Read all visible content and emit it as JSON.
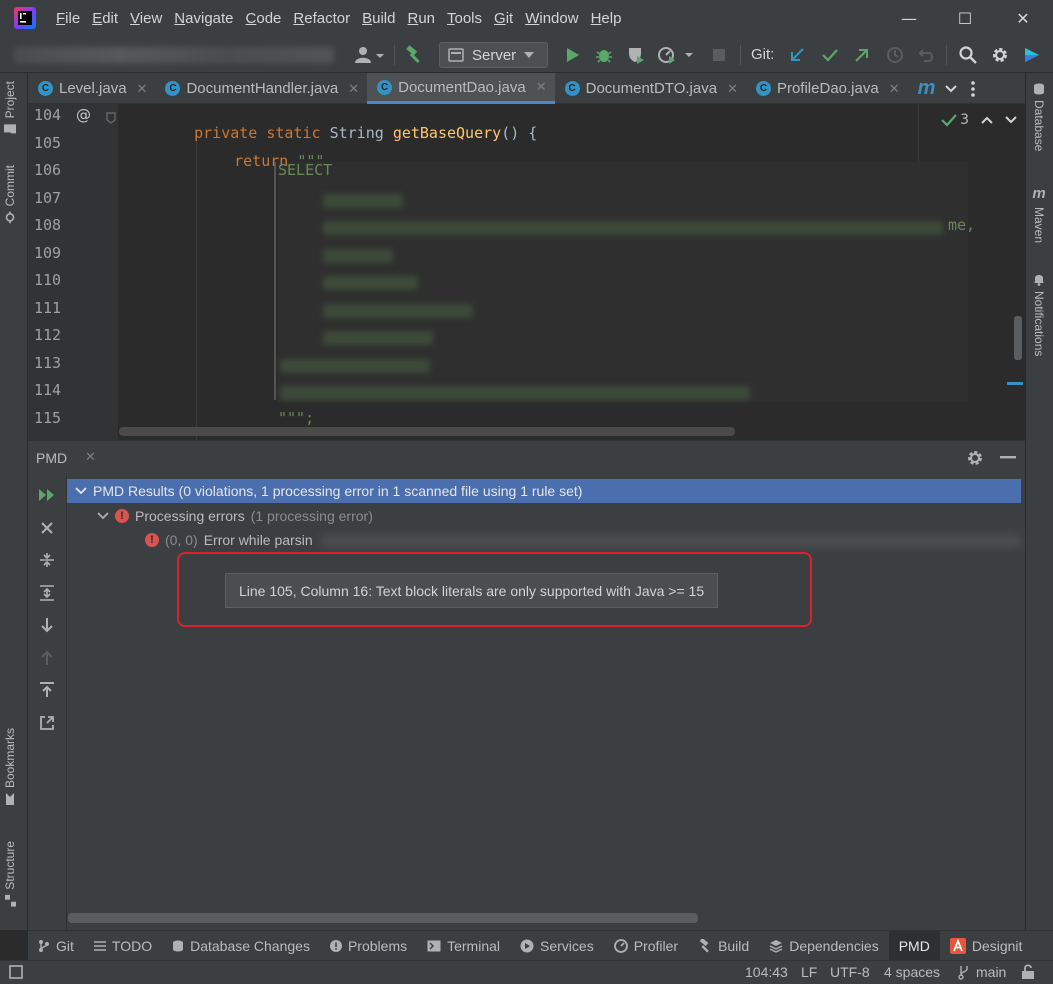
{
  "menu": [
    "File",
    "Edit",
    "View",
    "Navigate",
    "Code",
    "Refactor",
    "Build",
    "Run",
    "Tools",
    "Git",
    "Window",
    "Help"
  ],
  "window_controls": {
    "minimize": "—",
    "maximize": "☐",
    "close": "✕"
  },
  "toolbar": {
    "run_config": "Server",
    "git_label": "Git:"
  },
  "left_strip": {
    "project": "Project",
    "commit": "Commit",
    "bookmarks": "Bookmarks",
    "structure": "Structure"
  },
  "right_strip": {
    "database": "Database",
    "maven": "Maven",
    "notifications": "Notifications"
  },
  "tabs": [
    {
      "label": "Level.java",
      "active": false,
      "icon": "generic-file-icon"
    },
    {
      "label": "DocumentHandler.java",
      "active": false,
      "icon": "class-icon"
    },
    {
      "label": "DocumentDao.java",
      "active": true,
      "icon": "class-icon"
    },
    {
      "label": "DocumentDTO.java",
      "active": false,
      "icon": "class-icon"
    },
    {
      "label": "ProfileDao.java",
      "active": false,
      "icon": "class-icon"
    }
  ],
  "editor": {
    "line_numbers": [
      "104",
      "105",
      "106",
      "107",
      "108",
      "109",
      "110",
      "111",
      "112",
      "113",
      "114",
      "115"
    ],
    "line104": {
      "mods": "private static ",
      "type": "String ",
      "method": "getBaseQuery",
      "rest": "() {"
    },
    "line105": {
      "kw": "return ",
      "str": "\"\"\""
    },
    "line106": "SELECT",
    "line108_tail": "me,",
    "line115": "\"\"\";",
    "inspection_count": "3"
  },
  "pmd": {
    "panel_title": "PMD",
    "root": "PMD Results (0 violations, 1 processing error in 1 scanned file using 1 rule set)",
    "processing_errors": "Processing errors",
    "processing_errors_count": "(1 processing error)",
    "error_pos": "(0, 0)",
    "error_text": "Error while parsin",
    "tooltip": "Line 105, Column 16: Text block literals are only supported with Java >= 15"
  },
  "bottom_tabs": [
    {
      "label": "Git",
      "icon": "git-branch-icon"
    },
    {
      "label": "TODO",
      "icon": "list-icon"
    },
    {
      "label": "Database Changes",
      "icon": "database-icon"
    },
    {
      "label": "Problems",
      "icon": "warning-icon"
    },
    {
      "label": "Terminal",
      "icon": "terminal-icon"
    },
    {
      "label": "Services",
      "icon": "play-circle-icon"
    },
    {
      "label": "Profiler",
      "icon": "gauge-icon"
    },
    {
      "label": "Build",
      "icon": "hammer-icon"
    },
    {
      "label": "Dependencies",
      "icon": "layers-icon"
    },
    {
      "label": "PMD",
      "icon": ""
    },
    {
      "label": "Designit",
      "icon": "designit-icon"
    }
  ],
  "status": {
    "position": "104:43",
    "line_sep": "LF",
    "encoding": "UTF-8",
    "indent": "4 spaces",
    "branch": "main"
  },
  "colors": {
    "accent": "#4b6eaf",
    "error": "#d9534f",
    "run_green": "#59a869",
    "frame_red": "#e0202a"
  }
}
